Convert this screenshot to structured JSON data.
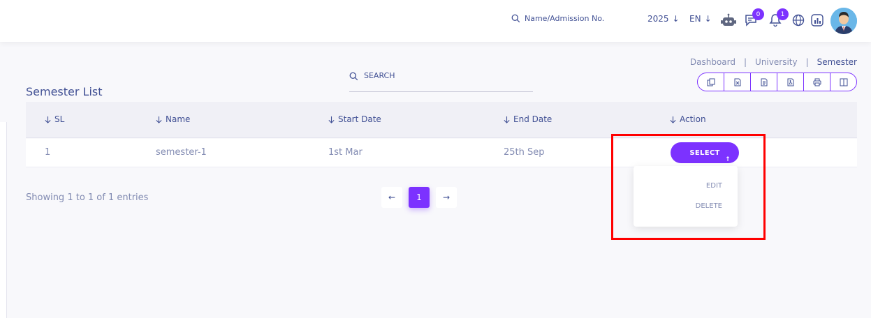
{
  "header": {
    "search_label": "Name/Admission No.",
    "year": "2025",
    "language": "EN",
    "messages_count": "0",
    "notifications_count": "1"
  },
  "breadcrumb": {
    "items": [
      "Dashboard",
      "University",
      "Semester"
    ],
    "separator": "|"
  },
  "page_title": "Semester List",
  "search": {
    "label": "SEARCH"
  },
  "export_buttons": [
    "copy-icon",
    "excel-icon",
    "csv-icon",
    "pdf-icon",
    "print-icon",
    "columns-icon"
  ],
  "table": {
    "columns": [
      "SL",
      "Name",
      "Start Date",
      "End Date",
      "Action"
    ],
    "rows": [
      {
        "sl": "1",
        "name": "semester-1",
        "start": "1st Mar",
        "end": "25th Sep"
      }
    ]
  },
  "action": {
    "select_label": "SELECT",
    "menu": [
      "EDIT",
      "DELETE"
    ]
  },
  "pagination": {
    "info": "Showing 1 to 1 of 1 entries",
    "prev": "←",
    "current": "1",
    "next": "→"
  },
  "colors": {
    "accent": "#7c32ff",
    "highlight": "#ff0000",
    "text": "#415094"
  }
}
